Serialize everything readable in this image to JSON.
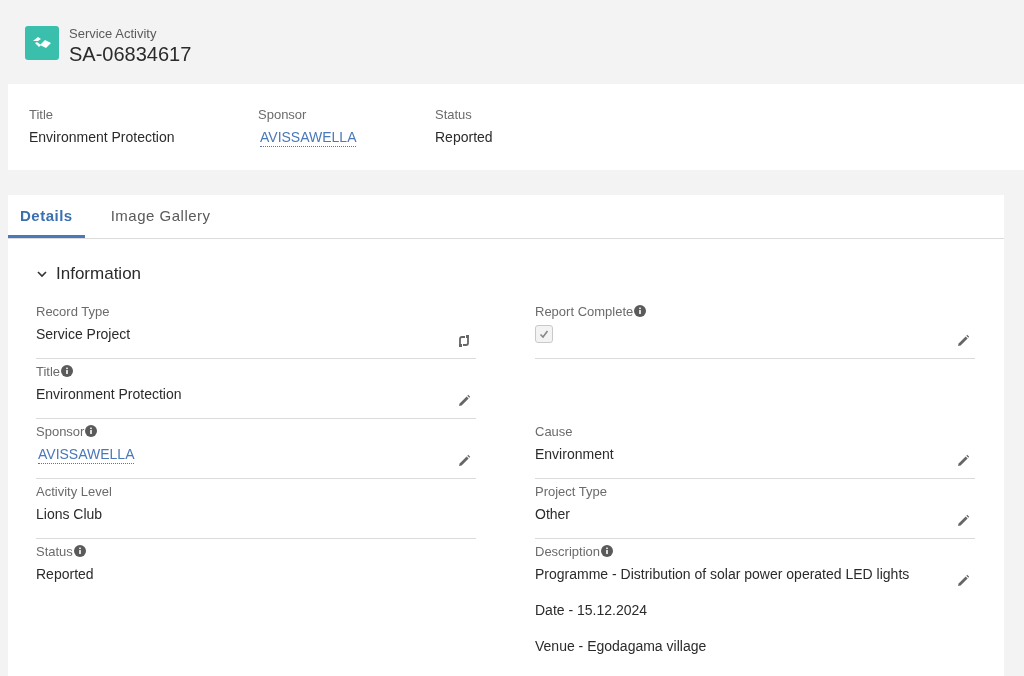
{
  "header": {
    "object_type": "Service Activity",
    "record_name": "SA-06834617"
  },
  "highlights": [
    {
      "label": "Title",
      "value": "Environment Protection",
      "kind": "text"
    },
    {
      "label": "Sponsor",
      "value": "AVISSAWELLA",
      "kind": "link"
    },
    {
      "label": "Status",
      "value": "Reported",
      "kind": "text"
    }
  ],
  "tabs": [
    {
      "label": "Details",
      "selected": true
    },
    {
      "label": "Image Gallery",
      "selected": false
    }
  ],
  "section": {
    "title": "Information",
    "expanded": true
  },
  "rows": [
    {
      "left": {
        "label": "Record Type",
        "info": false,
        "kind": "text",
        "value": [
          "Service Project"
        ],
        "editable": false,
        "type_switch": true
      },
      "right": {
        "label": "Report Complete",
        "info": true,
        "kind": "checkbox",
        "checked": true,
        "editable": true
      }
    },
    {
      "left": {
        "label": "Title",
        "info": true,
        "kind": "text",
        "value": [
          "Environment Protection"
        ],
        "editable": true
      }
    },
    {
      "left": {
        "label": "Sponsor",
        "info": true,
        "kind": "link",
        "value": [
          "AVISSAWELLA"
        ],
        "editable": true
      },
      "right": {
        "label": "Cause",
        "info": false,
        "kind": "text",
        "value": [
          "Environment"
        ],
        "editable": true
      }
    },
    {
      "left": {
        "label": "Activity Level",
        "info": false,
        "kind": "text",
        "value": [
          "Lions Club"
        ],
        "editable": false
      },
      "right": {
        "label": "Project Type",
        "info": false,
        "kind": "text",
        "value": [
          "Other"
        ],
        "editable": true
      }
    },
    {
      "left": {
        "label": "Status",
        "info": true,
        "kind": "text",
        "value": [
          "Reported"
        ],
        "editable": false
      },
      "right": {
        "label": "Description",
        "info": true,
        "kind": "text",
        "value": [
          "Programme - Distribution of solar power operated LED lights",
          "Date - 15.12.2024",
          "Venue - Egodagama village"
        ],
        "editable": true
      }
    }
  ]
}
